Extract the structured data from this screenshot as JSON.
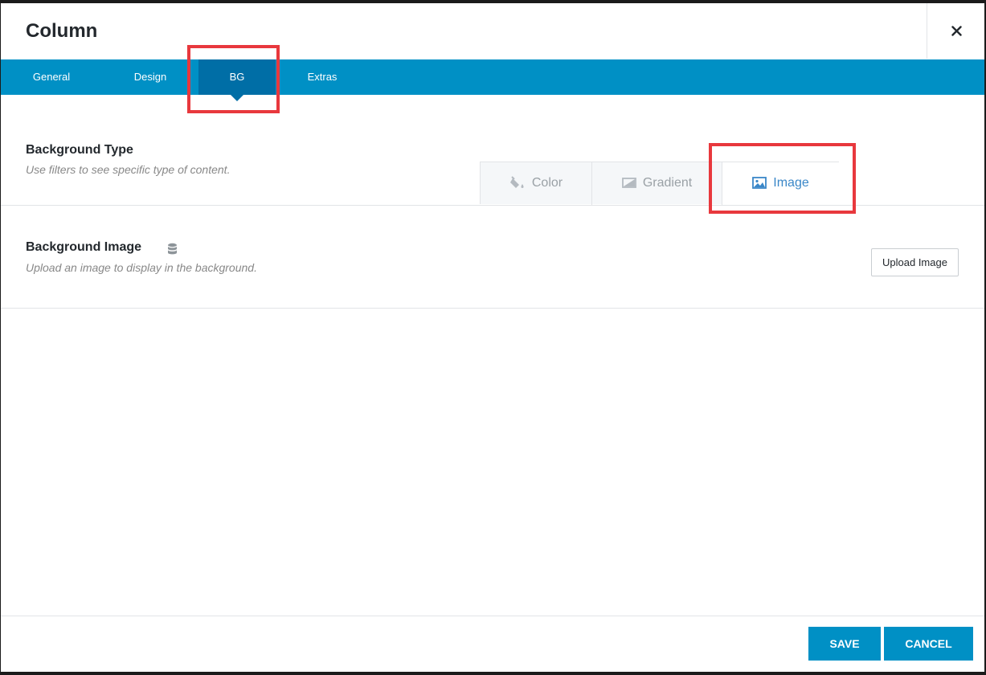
{
  "dialog": {
    "title": "Column",
    "close_icon": "close-icon"
  },
  "tabs": [
    {
      "label": "General",
      "active": false
    },
    {
      "label": "Design",
      "active": false
    },
    {
      "label": "BG",
      "active": true
    },
    {
      "label": "Extras",
      "active": false
    }
  ],
  "background_type": {
    "label": "Background Type",
    "description": "Use filters to see specific type of content.",
    "options": [
      {
        "label": "Color",
        "icon": "paint-bucket-icon",
        "active": false
      },
      {
        "label": "Gradient",
        "icon": "gradient-icon",
        "active": false
      },
      {
        "label": "Image",
        "icon": "image-icon",
        "active": true
      }
    ]
  },
  "background_image": {
    "label": "Background Image",
    "icon": "database-icon",
    "description": "Upload an image to display in the background.",
    "upload_label": "Upload Image"
  },
  "footer": {
    "save_label": "SAVE",
    "cancel_label": "CANCEL"
  },
  "colors": {
    "accent": "#0090c5",
    "active_tab": "#006ea6",
    "highlight": "#e8383d",
    "active_option": "#3a87c8"
  }
}
